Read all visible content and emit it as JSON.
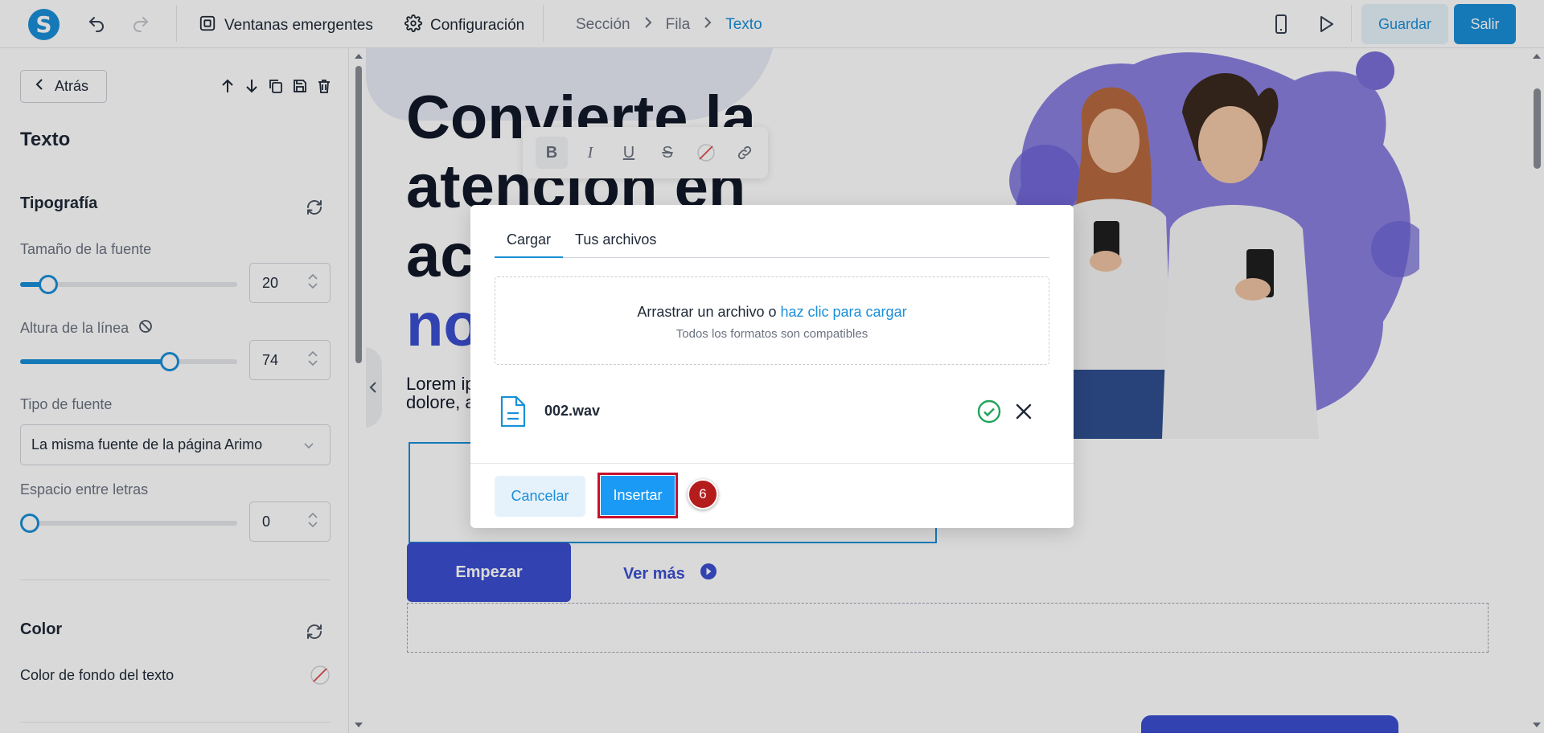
{
  "topbar": {
    "logo_letter": "S",
    "popups_label": "Ventanas emergentes",
    "settings_label": "Configuración",
    "breadcrumb": [
      "Sección",
      "Fila",
      "Texto"
    ],
    "save_label": "Guardar",
    "exit_label": "Salir"
  },
  "sidebar": {
    "back_label": "Atrás",
    "title": "Texto",
    "typography_title": "Tipografía",
    "font_size_label": "Tamaño de la fuente",
    "font_size_value": "20",
    "font_size_slider": 0.13,
    "line_height_label": "Altura de la línea",
    "line_height_value": "74",
    "line_height_slider": 0.69,
    "font_type_label": "Tipo de fuente",
    "font_type_value": "La misma fuente de la página Arimo",
    "letter_spacing_label": "Espacio entre letras",
    "letter_spacing_value": "0",
    "letter_spacing_slider": 0.0,
    "color_title": "Color",
    "text_bg_label": "Color de fondo del texto"
  },
  "canvas": {
    "headline_lines": [
      "Convierte la",
      "atención en",
      "ac",
      "no"
    ],
    "lorem_lines": [
      "Lorem ip",
      "dolore, a"
    ],
    "start_button": "Empezar",
    "see_more": "Ver más"
  },
  "modal": {
    "tab_upload": "Cargar",
    "tab_files": "Tus archivos",
    "drop_text": "Arrastrar un archivo o ",
    "drop_link": "haz clic para cargar",
    "drop_hint": "Todos los formatos son compatibles",
    "file_name": "002.wav",
    "cancel_label": "Cancelar",
    "insert_label": "Insertar"
  },
  "annotation": {
    "step": "6"
  },
  "colors": {
    "accent": "#1a8fd8",
    "brand": "#3b4fd0",
    "badge": "#b51d1d",
    "success": "#22a35a"
  }
}
